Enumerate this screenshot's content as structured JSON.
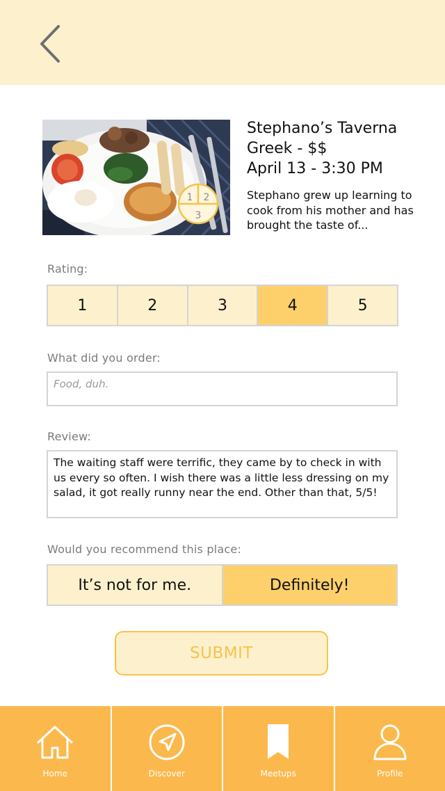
{
  "restaurant": {
    "name": "Stephano’s Taverna",
    "cuisine_price": "Greek - $$",
    "datetime": "April 13 - 3:30 PM",
    "description": "Stephano grew up learning to cook from his mother and has brought the taste of..."
  },
  "rating": {
    "label": "Rating:",
    "options": [
      "1",
      "2",
      "3",
      "4",
      "5"
    ],
    "selected": "4"
  },
  "order": {
    "label": "What did you order:",
    "placeholder": "Food, duh.",
    "value": ""
  },
  "review": {
    "label": "Review:",
    "value": "The waiting staff were terrific, they came by to check in with us every so often. I wish there was a little less dressing on my salad, it got really runny near the end. Other than that, 5/5!"
  },
  "recommend": {
    "label": "Would you recommend this place:",
    "options": [
      "It’s not for me.",
      "Definitely!"
    ],
    "selected": "Definitely!"
  },
  "submit_label": "SUBMIT",
  "tabs": [
    {
      "label": "Home",
      "icon": "home-icon"
    },
    {
      "label": "Discover",
      "icon": "compass-icon"
    },
    {
      "label": "Meetups",
      "icon": "bookmark-icon"
    },
    {
      "label": "Profile",
      "icon": "person-icon"
    }
  ],
  "colors": {
    "header_bg": "#fdf1cd",
    "selected": "#fdd06c",
    "tab_bar": "#fbb84c",
    "submit_text": "#f8c24e"
  }
}
